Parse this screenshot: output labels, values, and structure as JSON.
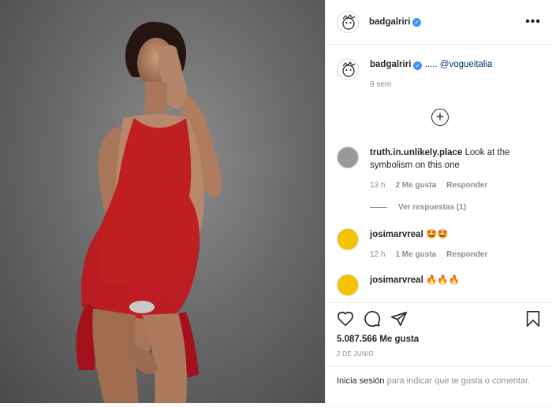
{
  "post": {
    "author": "badgalriri",
    "caption_text": "..... ",
    "caption_mention": "@vogueitalia",
    "caption_time": "9 sem",
    "likes": "5.087.566 Me gusta",
    "date": "2 DE JUNIO"
  },
  "comments": [
    {
      "user": "truth.in.unlikely.place",
      "text": "Look at the symbolism on this one",
      "time": "13 h",
      "likes": "2 Me gusta",
      "reply": "Responder",
      "view_replies": "Ver respuestas (1)"
    },
    {
      "user": "josimarvreal",
      "text": "🤩🤩",
      "time": "12 h",
      "likes": "1 Me gusta",
      "reply": "Responder"
    },
    {
      "user": "josimarvreal",
      "text": "🔥🔥🔥"
    }
  ],
  "login": {
    "link": "Inicia sesión",
    "rest": "para indicar que te gusta o comentar."
  },
  "icons": [
    "more-icon",
    "verified-icon",
    "load-more-icon",
    "heart-icon",
    "comment-icon",
    "share-icon",
    "save-icon"
  ],
  "colors": {
    "verified": "#3897f0",
    "dress": "#c0161c",
    "background_photo": "#6b6b6b"
  }
}
